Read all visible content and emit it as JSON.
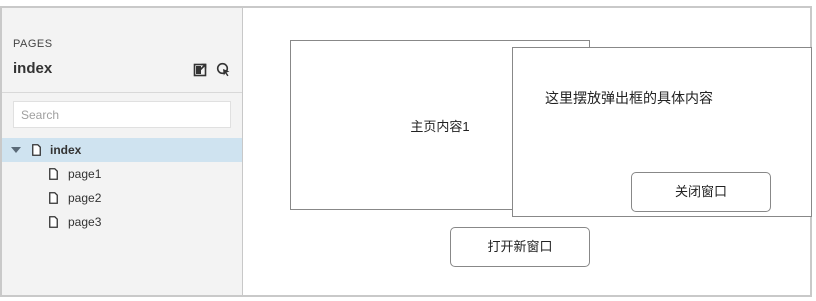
{
  "sidebar": {
    "section_label": "PAGES",
    "current_page": "index",
    "icons": {
      "export": "export-icon",
      "locate": "locate-page-icon"
    },
    "search": {
      "placeholder": "Search",
      "value": ""
    },
    "tree": {
      "root": {
        "label": "index",
        "expanded": true,
        "selected": true
      },
      "children": [
        {
          "label": "page1"
        },
        {
          "label": "page2"
        },
        {
          "label": "page3"
        }
      ]
    }
  },
  "canvas": {
    "main_content": "主页内容1",
    "popup": {
      "content": "这里摆放弹出框的具体内容",
      "close_button": "关闭窗口"
    },
    "open_button": "打开新窗口"
  },
  "colors": {
    "sidebar_bg": "#f3f3f3",
    "selected_row": "#cfe3f0",
    "border": "#888888"
  }
}
